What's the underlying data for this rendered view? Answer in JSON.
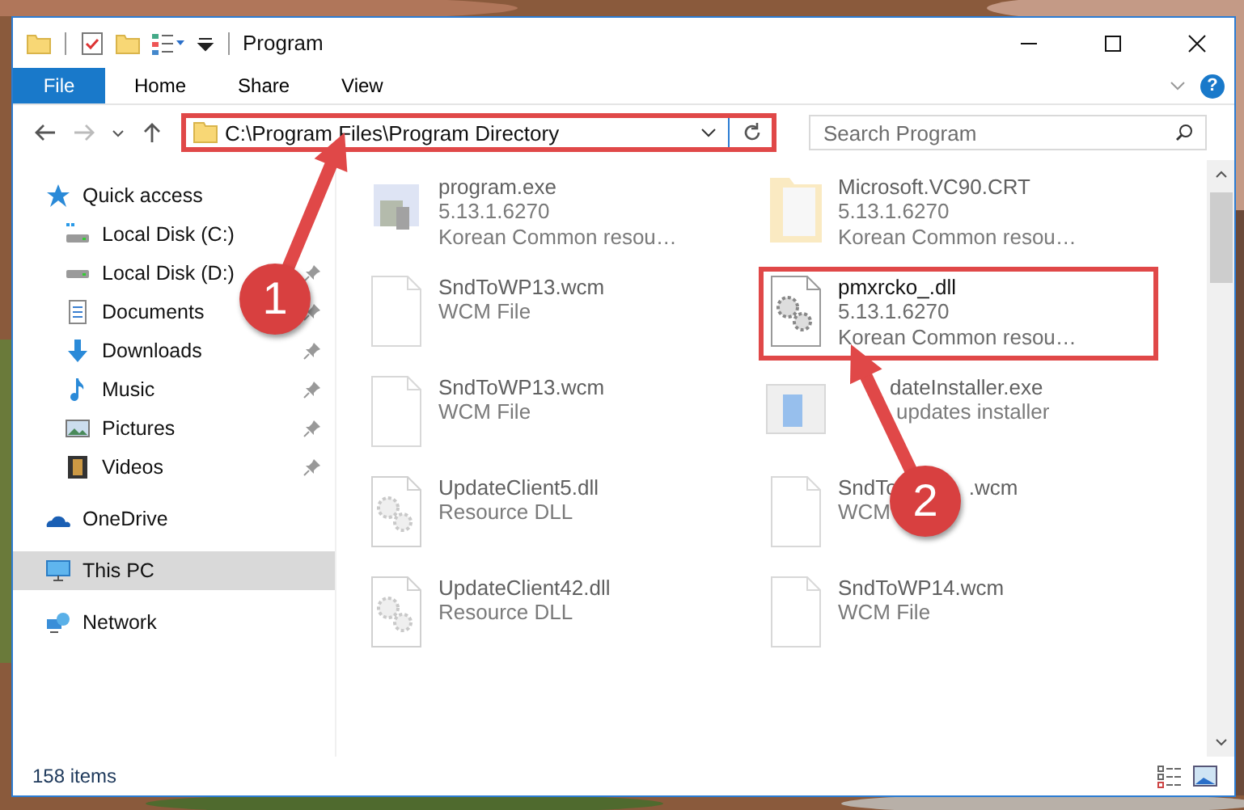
{
  "window": {
    "title": "Program"
  },
  "ribbon_tabs": [
    {
      "label": "File",
      "kind": "file"
    },
    {
      "label": "Home",
      "kind": "tab"
    },
    {
      "label": "Share",
      "kind": "tab"
    },
    {
      "label": "View",
      "kind": "tab"
    }
  ],
  "help": "?",
  "address": {
    "path": "C:\\Program Files\\Program Directory",
    "highlighted": true
  },
  "search": {
    "placeholder": "Search Program"
  },
  "sidebar": {
    "items": [
      {
        "label": "Quick access",
        "kind": "star",
        "selected": false,
        "children": [
          {
            "label": "Local Disk (C:)",
            "kind": "drive-c",
            "pinned": false,
            "selected": false
          },
          {
            "label": "Local Disk (D:)",
            "kind": "drive",
            "pinned": true,
            "selected": false
          },
          {
            "label": "Documents",
            "kind": "documents",
            "pinned": true,
            "selected": false
          },
          {
            "label": "Downloads",
            "kind": "downloads",
            "pinned": true,
            "selected": false
          },
          {
            "label": "Music",
            "kind": "music",
            "pinned": true,
            "selected": false
          },
          {
            "label": "Pictures",
            "kind": "pictures",
            "pinned": true,
            "selected": false
          },
          {
            "label": "Videos",
            "kind": "videos",
            "pinned": true,
            "selected": false
          }
        ]
      },
      {
        "label": "OneDrive",
        "kind": "cloud",
        "selected": false
      },
      {
        "label": "This PC",
        "kind": "pc",
        "selected": true
      },
      {
        "label": "Network",
        "kind": "network",
        "selected": false
      }
    ]
  },
  "files": [
    {
      "name": "program.exe",
      "lines": [
        "5.13.1.6270",
        "Korean Common resou…"
      ],
      "kind": "exe",
      "blurred": true,
      "highlighted": false
    },
    {
      "name": "Microsoft.VC90.CRT",
      "lines": [
        "5.13.1.6270",
        "Korean Common resou…"
      ],
      "kind": "folder",
      "blurred": true,
      "highlighted": false
    },
    {
      "name": "SndToWP13.wcm",
      "lines": [
        "WCM File"
      ],
      "kind": "file",
      "blurred": true,
      "highlighted": false
    },
    {
      "name": "pmxrcko_.dll",
      "lines": [
        "5.13.1.6270",
        "Korean Common resou…"
      ],
      "kind": "dll",
      "blurred": false,
      "highlighted": true
    },
    {
      "name": "SndToWP13.wcm",
      "lines": [
        "WCM File"
      ],
      "kind": "file",
      "blurred": true,
      "highlighted": false
    },
    {
      "name": "dateInstaller.exe",
      "lines": [
        "updates installer"
      ],
      "kind": "installer",
      "blurred": true,
      "highlighted": false
    },
    {
      "name": "UpdateClient5.dll",
      "lines": [
        "Resource DLL"
      ],
      "kind": "dll",
      "blurred": true,
      "highlighted": false
    },
    {
      "name": "SndTo",
      "name_tail": ".wcm",
      "lines": [
        "WCM"
      ],
      "kind": "file",
      "blurred": true,
      "highlighted": false
    },
    {
      "name": "UpdateClient42.dll",
      "lines": [
        "Resource DLL"
      ],
      "kind": "dll",
      "blurred": true,
      "highlighted": false
    },
    {
      "name": "SndToWP14.wcm",
      "lines": [
        "WCM File"
      ],
      "kind": "file",
      "blurred": true,
      "highlighted": false
    }
  ],
  "status_bar": {
    "count": "158 items"
  },
  "annotations": [
    {
      "number": "1"
    },
    {
      "number": "2"
    }
  ]
}
